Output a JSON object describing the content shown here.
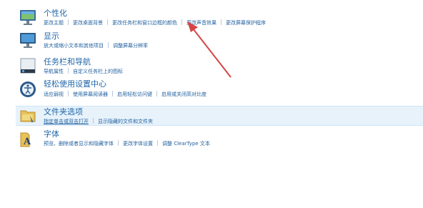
{
  "categories": [
    {
      "id": "personalization",
      "icon": "personalization-monitor-icon",
      "title": "个性化",
      "links": [
        "更改主题",
        "更改桌面背景",
        "更改任务栏和窗口边框的颜色",
        "更改声音效果",
        "更改屏幕保护程序"
      ]
    },
    {
      "id": "display",
      "icon": "display-monitor-icon",
      "title": "显示",
      "links": [
        "放大或缩小文本和其他项目",
        "调整屏幕分辨率"
      ]
    },
    {
      "id": "taskbar",
      "icon": "taskbar-icon",
      "title": "任务栏和导航",
      "links": [
        "导航属性",
        "自定义任务栏上的图标"
      ]
    },
    {
      "id": "ease-of-access",
      "icon": "ease-of-access-icon",
      "title": "轻松使用设置中心",
      "links": [
        "适应弱视",
        "使用屏幕阅读器",
        "启用轻松访问键",
        "启用或关闭高对比度"
      ]
    },
    {
      "id": "folder-options",
      "icon": "folder-options-icon",
      "title": "文件夹选项",
      "links": [
        "指定单击或双击打开",
        "显示隐藏的文件和文件夹"
      ]
    },
    {
      "id": "fonts",
      "icon": "fonts-icon",
      "title": "字体",
      "links": [
        "预览、删除或者显示和隐藏字体",
        "更改字体设置",
        "调整 ClearType 文本"
      ]
    }
  ],
  "annotation": {
    "arrow_color": "#d64545"
  }
}
